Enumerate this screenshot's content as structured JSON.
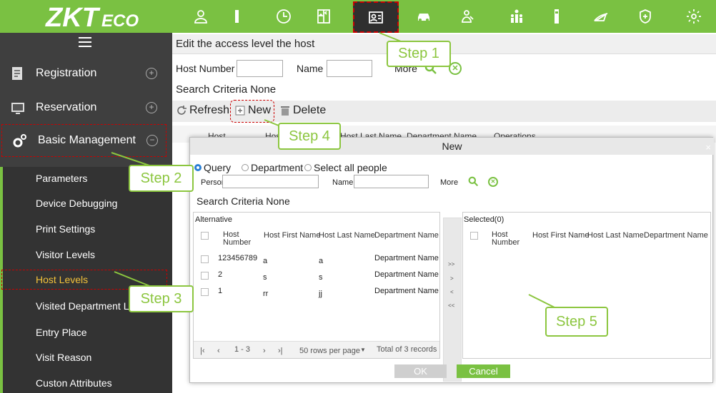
{
  "brand": "ZKTeco",
  "nav": {
    "icons": [
      "user-icon",
      "door-icon",
      "clock-icon",
      "elevator-icon",
      "visitor-icon",
      "car-icon",
      "patrol-icon",
      "org-icon",
      "tower-icon",
      "pen-icon",
      "shield-icon",
      "settings-icon"
    ],
    "active_index": 4
  },
  "sidebar": {
    "main": [
      {
        "label": "Registration",
        "toggle": "+"
      },
      {
        "label": "Reservation",
        "toggle": "+"
      },
      {
        "label": "Basic Management",
        "toggle": "−"
      }
    ],
    "sub": [
      "Parameters",
      "Device Debugging",
      "Print Settings",
      "Visitor Levels",
      "Host Levels",
      "Visited Department Levels",
      "Entry Place",
      "Visit Reason",
      "Custon Attributes"
    ],
    "active_sub": "Host Levels"
  },
  "main": {
    "title": "Edit the access level the host",
    "filter": {
      "host_number_label": "Host Number",
      "name_label": "Name",
      "more_label": "More"
    },
    "criteria": "Search Criteria None",
    "toolbar": {
      "refresh": "Refresh",
      "new": "New",
      "delete": "Delete"
    },
    "grid_headers": [
      "Host",
      "Host First Name",
      "Host Last Name",
      "Department Name",
      "Operations"
    ]
  },
  "modal": {
    "title": "New",
    "close": "×",
    "radios": [
      {
        "label": "Query",
        "selected": true
      },
      {
        "label": "Department",
        "selected": false
      },
      {
        "label": "Select all people",
        "selected": false
      }
    ],
    "personnel_id_label": "Personnel ID",
    "name_label": "Name",
    "more_label": "More",
    "criteria": "Search Criteria None",
    "alternative": {
      "title": "Alternative",
      "headers": [
        "Host Number",
        "Host First Name",
        "Host Last Name",
        "Department Name"
      ],
      "rows": [
        [
          "123456789",
          "a",
          "a",
          "Department Name"
        ],
        [
          "2",
          "s",
          "s",
          "Department Name"
        ],
        [
          "1",
          "rr",
          "jj",
          "Department Name"
        ]
      ],
      "pager": {
        "range": "1 - 3",
        "per_page": "50 rows per page",
        "total": "Total of 3 records"
      }
    },
    "transfer": [
      ">>",
      ">",
      "<",
      "<<"
    ],
    "selected": {
      "title": "Selected(0)",
      "headers": [
        "Host Number",
        "Host First Name",
        "Host Last Name",
        "Department Name"
      ]
    },
    "ok": "OK",
    "cancel": "Cancel"
  },
  "steps": [
    "Step 1",
    "Step 2",
    "Step 3",
    "Step 4",
    "Step 5"
  ],
  "colors": {
    "brand_green": "#7ac142",
    "sidebar": "#3f3f3f",
    "active_sub": "#f3c23a",
    "highlight": "#cc0000"
  }
}
